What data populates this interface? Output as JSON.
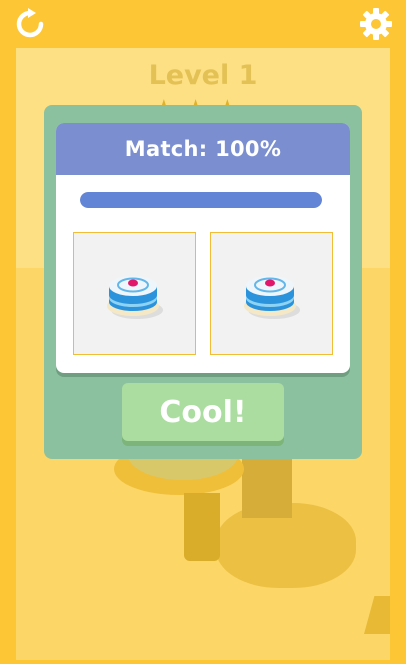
{
  "header": {
    "restart_icon": "restart-icon",
    "settings_icon": "gear-icon"
  },
  "level": {
    "title": "Level 1",
    "stars": 3
  },
  "result": {
    "title": "Match: 100%",
    "match_percent": 100,
    "target_label": "target cake",
    "made_label": "made cake"
  },
  "actions": {
    "cool_label": "Cool!"
  },
  "colors": {
    "background": "#fdc634",
    "modal": "#8cc1a0",
    "header": "#7b8fd0",
    "bar": "#6385d6",
    "button": "#aadd9f"
  }
}
